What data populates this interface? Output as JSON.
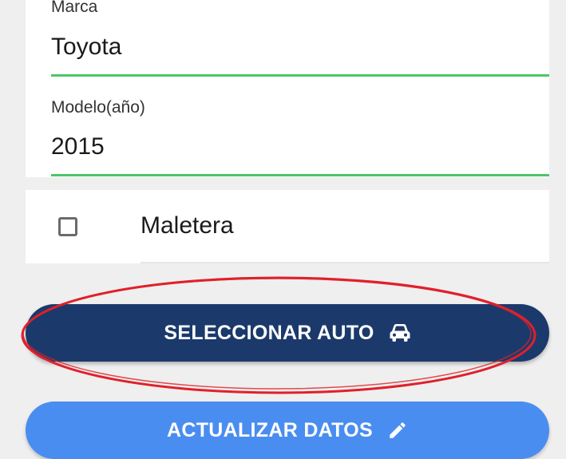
{
  "form": {
    "marca": {
      "label": "Marca",
      "value": "Toyota"
    },
    "modelo": {
      "label": "Modelo(año)",
      "value": "2015"
    },
    "maletera": {
      "label": "Maletera",
      "checked": false
    }
  },
  "buttons": {
    "select_car": {
      "label": "SELECCIONAR AUTO",
      "icon": "car-icon",
      "color": "#1b3a6b"
    },
    "update_data": {
      "label": "ACTUALIZAR DATOS",
      "icon": "pencil-icon",
      "color": "#4a8df0"
    }
  },
  "colors": {
    "field_underline": "#4cc66a",
    "annotation_circle": "#e0202a"
  }
}
